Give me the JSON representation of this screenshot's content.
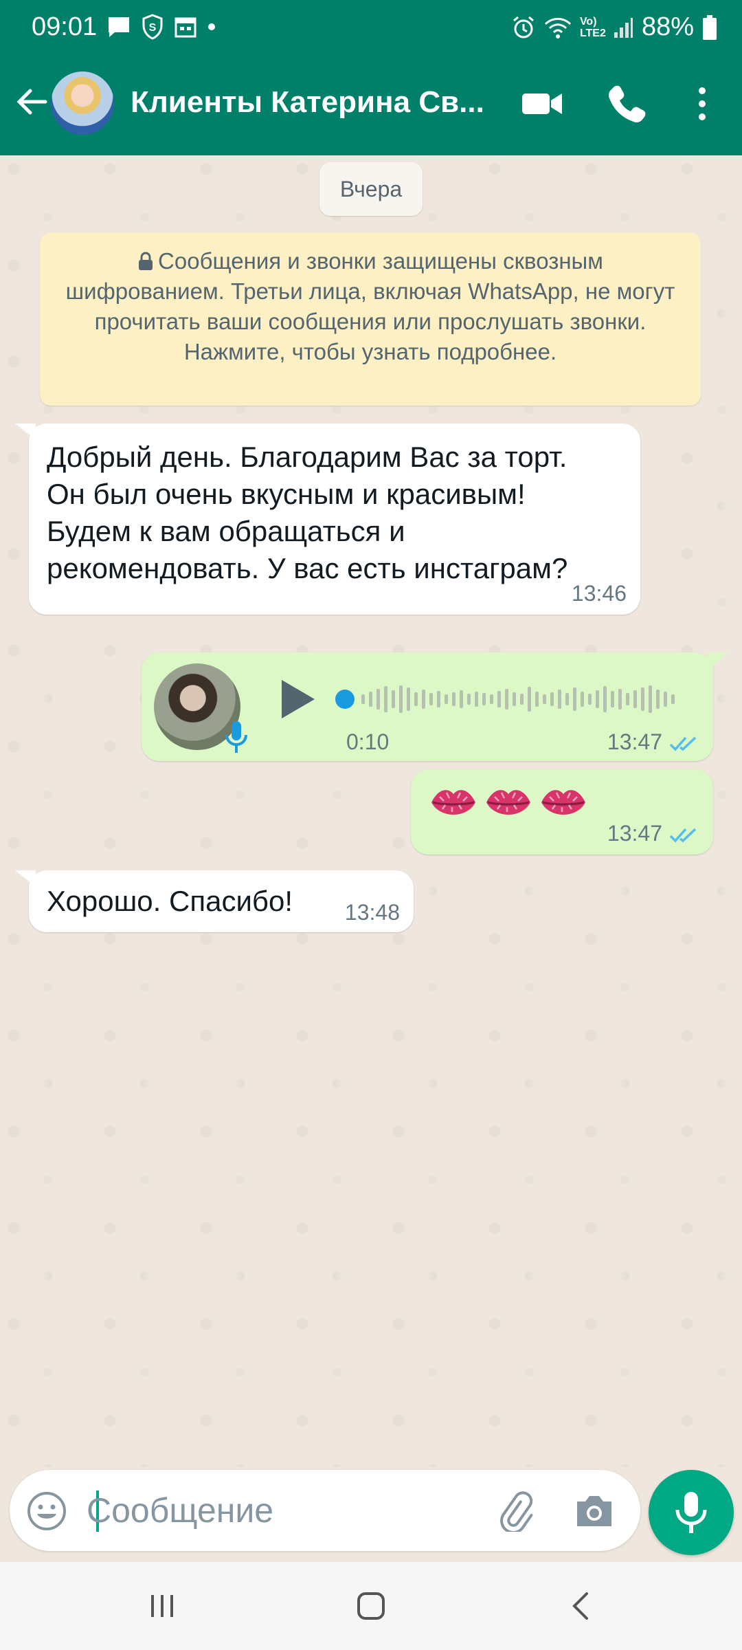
{
  "status_bar": {
    "time": "09:01",
    "battery": "88%",
    "icons_left": [
      "message-icon",
      "shield-s-icon",
      "calendar-icon",
      "dot-icon"
    ],
    "icons_right": [
      "alarm-icon",
      "wifi-icon",
      "volte-lte2-icon",
      "signal-icon",
      "battery-icon"
    ],
    "network_label": "Vo) LTE2"
  },
  "header": {
    "title": "Клиенты Катерина Св...",
    "icons": [
      "back-arrow-icon",
      "video-call-icon",
      "phone-call-icon",
      "more-vert-icon"
    ]
  },
  "chat": {
    "date_separator": "Вчера",
    "encryption_notice": "Сообщения и звонки защищены сквозным шифрованием. Третьи лица, включая WhatsApp, не могут прочитать ваши сообщения или прослушать звонки. Нажмите, чтобы узнать подробнее.",
    "messages": [
      {
        "direction": "in",
        "text": "Добрый день. Благодарим Вас за торт. Он был очень вкусным и красивым! Будем к вам обращаться и рекомендовать. У вас есть инстаграм?",
        "time": "13:46"
      },
      {
        "direction": "out",
        "type": "voice",
        "duration": "0:10",
        "time": "13:47",
        "status": "read"
      },
      {
        "direction": "out",
        "type": "emoji",
        "emoji_count": 3,
        "emoji_name": "kiss-lips",
        "time": "13:47",
        "status": "read"
      },
      {
        "direction": "in",
        "text": "Хорошо. Спасибо!",
        "time": "13:48"
      }
    ]
  },
  "composer": {
    "placeholder": "Сообщение",
    "icons": [
      "emoji-icon",
      "attach-icon",
      "camera-icon",
      "mic-icon"
    ]
  },
  "colors": {
    "header": "#008069",
    "accent": "#00a884",
    "incoming_bubble": "#ffffff",
    "outgoing_bubble": "#dcf8c6",
    "read_ticks": "#53bdeb",
    "notice_bg": "#fdf0c4"
  }
}
